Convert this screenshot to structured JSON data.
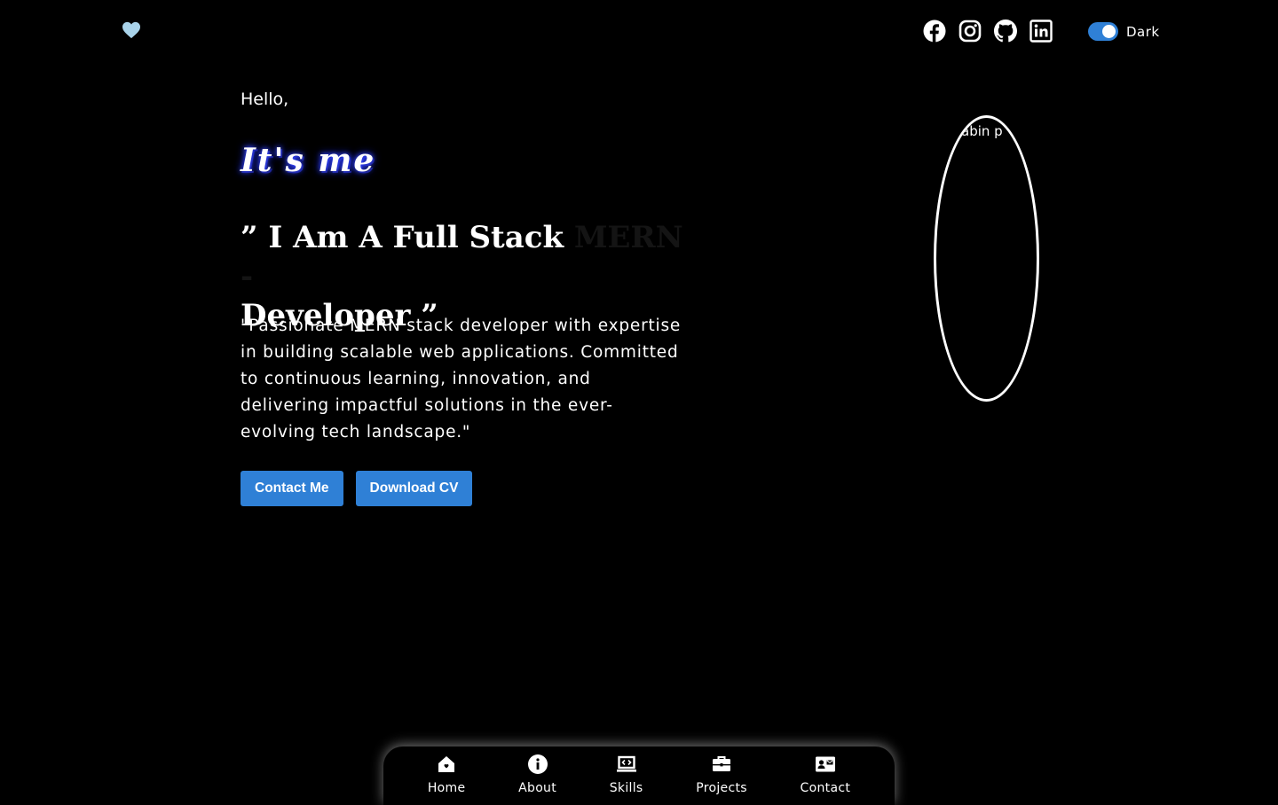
{
  "header": {
    "theme_label": "Dark",
    "theme_on": true,
    "accent": "#2f80d6",
    "socials": [
      {
        "icon": "facebook-icon"
      },
      {
        "icon": "instagram-icon"
      },
      {
        "icon": "github-icon"
      },
      {
        "icon": "linkedin-icon"
      }
    ]
  },
  "hero": {
    "greeting": "Hello,",
    "intro": "It's me",
    "headline_start": "” I Am A Full Stack ",
    "headline_dim": "MERN -",
    "headline_end": "Developer ”",
    "description": "\"Passionate MERN stack developer with expertise in building scalable web applications. Committed to continuous learning, innovation, and delivering impactful solutions in the ever-evolving tech landscape.\"",
    "buttons": {
      "contact": "Contact Me",
      "download": "Download CV"
    },
    "profile_alt": "abin p"
  },
  "nav": {
    "items": [
      {
        "label": "Home",
        "icon": "home-icon"
      },
      {
        "label": "About",
        "icon": "info-icon"
      },
      {
        "label": "Skills",
        "icon": "laptop-code-icon"
      },
      {
        "label": "Projects",
        "icon": "briefcase-icon"
      },
      {
        "label": "Contact",
        "icon": "contact-card-icon"
      }
    ]
  }
}
